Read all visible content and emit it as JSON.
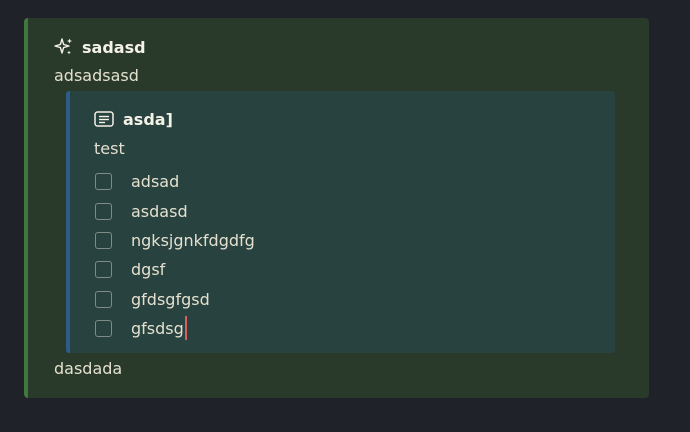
{
  "outer_callout": {
    "icon": "sparkle-icon",
    "title": "sadasd",
    "line_1": "adsadsasd",
    "line_2": "dasdada",
    "accent_color": "#3e7a3a"
  },
  "inner_callout": {
    "icon": "note-icon",
    "title": "asda]",
    "text": "test",
    "accent_color": "#2f5b8a",
    "tasks": [
      {
        "label": "adsad",
        "checked": false
      },
      {
        "label": "asdasd",
        "checked": false
      },
      {
        "label": "ngksjgnkfdgdfg",
        "checked": false
      },
      {
        "label": "dgsf",
        "checked": false
      },
      {
        "label": "gfdsgfgsd",
        "checked": false
      },
      {
        "label": "gfsdsg",
        "checked": false
      }
    ]
  }
}
